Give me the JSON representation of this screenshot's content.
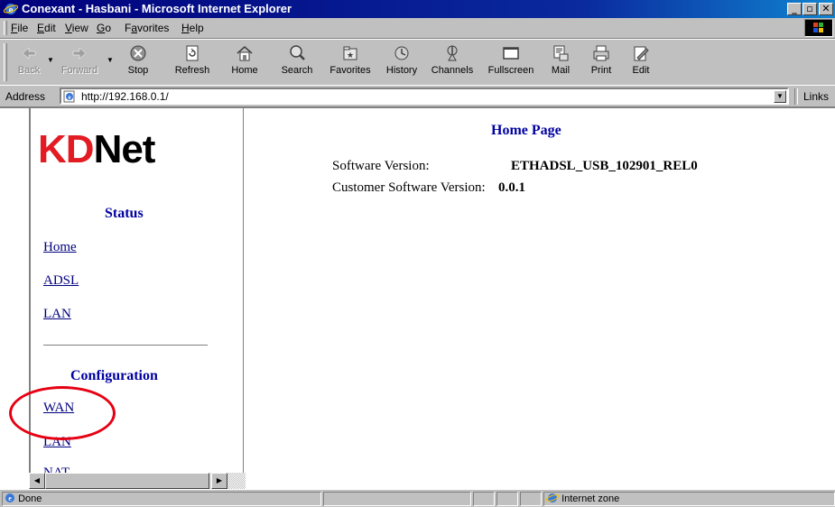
{
  "window": {
    "title": "Conexant - Hasbani - Microsoft Internet Explorer"
  },
  "menu": {
    "items": [
      {
        "label": "File",
        "ul": "F",
        "rest": "ile"
      },
      {
        "label": "Edit",
        "ul": "E",
        "rest": "dit"
      },
      {
        "label": "View",
        "ul": "V",
        "rest": "iew"
      },
      {
        "label": "Go",
        "ul": "G",
        "rest": "o"
      },
      {
        "label": "Favorites",
        "ul": "a",
        "pre": "F",
        "rest": "vorites"
      },
      {
        "label": "Help",
        "ul": "H",
        "rest": "elp"
      }
    ]
  },
  "toolbar": {
    "back": "Back",
    "forward": "Forward",
    "stop": "Stop",
    "refresh": "Refresh",
    "home": "Home",
    "search": "Search",
    "favorites": "Favorites",
    "history": "History",
    "channels": "Channels",
    "fullscreen": "Fullscreen",
    "mail": "Mail",
    "print": "Print",
    "edit": "Edit"
  },
  "address": {
    "label": "Address",
    "url": "http://192.168.0.1/",
    "links_label": "Links"
  },
  "nav": {
    "logo_kd": "KD",
    "logo_net": "Net",
    "status_heading": "Status",
    "status_links": [
      "Home",
      "ADSL",
      "LAN"
    ],
    "config_heading": "Configuration",
    "config_links": [
      "WAN",
      "LAN",
      "NAT"
    ]
  },
  "main": {
    "title": "Home Page",
    "software_version_label": "Software Version:",
    "software_version_value": "ETHADSL_USB_102901_REL0",
    "customer_version_label": "Customer Software Version:",
    "customer_version_value": "0.0.1"
  },
  "status": {
    "text": "Done",
    "zone": "Internet zone"
  },
  "colors": {
    "title_bar": "#00007b",
    "link": "#00007f",
    "heading": "#0000a0",
    "logo_red": "#e31b23",
    "annotation": "#e60012"
  }
}
